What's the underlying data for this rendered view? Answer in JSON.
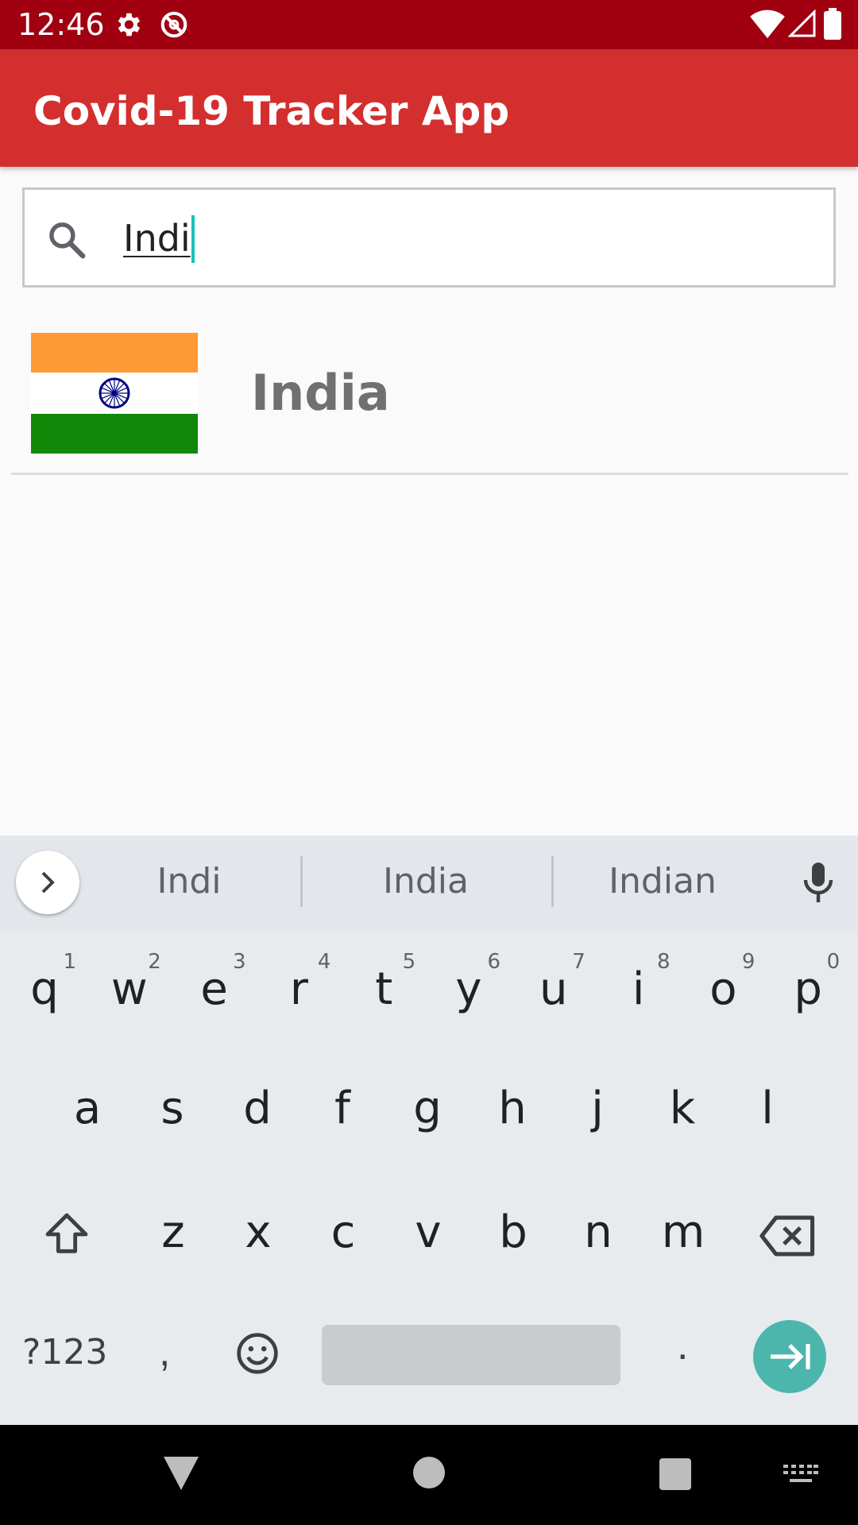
{
  "status_bar": {
    "time": "12:46",
    "icons": [
      "settings-icon",
      "no-disturb-icon",
      "wifi-icon",
      "signal-icon",
      "battery-icon"
    ]
  },
  "app_bar": {
    "title": "Covid-19 Tracker App",
    "color": "#d32f2f"
  },
  "search": {
    "value": "Indi",
    "icon": "search-icon"
  },
  "results": [
    {
      "country": "India",
      "flag": "india-flag"
    }
  ],
  "keyboard": {
    "suggestions": [
      "Indi",
      "India",
      "Indian"
    ],
    "row1": [
      {
        "k": "q",
        "h": "1"
      },
      {
        "k": "w",
        "h": "2"
      },
      {
        "k": "e",
        "h": "3"
      },
      {
        "k": "r",
        "h": "4"
      },
      {
        "k": "t",
        "h": "5"
      },
      {
        "k": "y",
        "h": "6"
      },
      {
        "k": "u",
        "h": "7"
      },
      {
        "k": "i",
        "h": "8"
      },
      {
        "k": "o",
        "h": "9"
      },
      {
        "k": "p",
        "h": "0"
      }
    ],
    "row2": [
      "a",
      "s",
      "d",
      "f",
      "g",
      "h",
      "j",
      "k",
      "l"
    ],
    "row3": [
      "z",
      "x",
      "c",
      "v",
      "b",
      "n",
      "m"
    ],
    "symbols_label": "?123",
    "comma": ",",
    "period": ".",
    "accent_color": "#4db6ac"
  },
  "nav_bar": {
    "icons": [
      "back-icon",
      "home-icon",
      "recents-icon",
      "keyboard-switch-icon"
    ]
  }
}
